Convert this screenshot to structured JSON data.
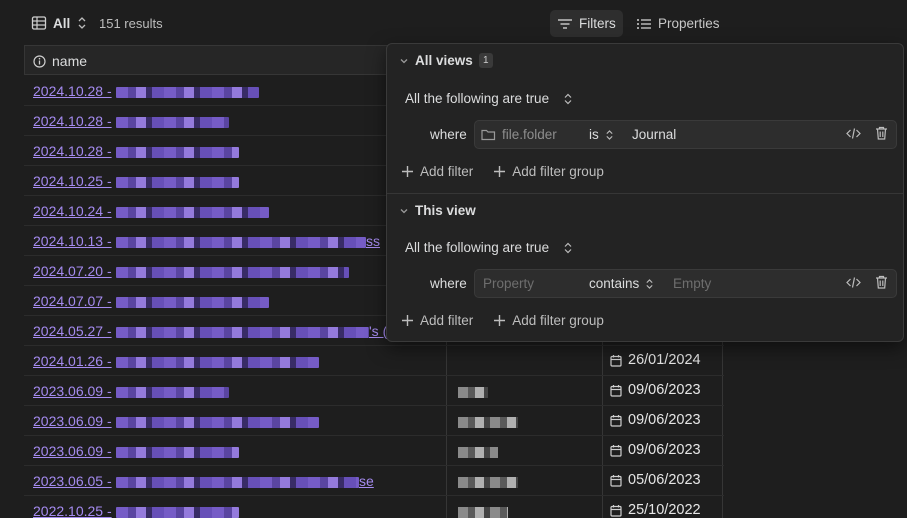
{
  "toolbar": {
    "view_label": "All",
    "results": "151 results",
    "filters_label": "Filters",
    "properties_label": "Properties"
  },
  "table": {
    "header_name": "name",
    "rows": [
      {
        "date": "2024.10.28 -",
        "blur_w": 143,
        "extra": "",
        "right": ""
      },
      {
        "date": "2024.10.28 -",
        "blur_w": 113,
        "extra": "",
        "right": ""
      },
      {
        "date": "2024.10.28 -",
        "blur_w": 123,
        "extra": "",
        "right": ""
      },
      {
        "date": "2024.10.25 -",
        "blur_w": 123,
        "extra": "",
        "right": ""
      },
      {
        "date": "2024.10.24 -",
        "blur_w": 153,
        "extra": "",
        "right": ""
      },
      {
        "date": "2024.10.13 -",
        "blur_w": 250,
        "extra": "ss",
        "right": ""
      },
      {
        "date": "2024.07.20 -",
        "blur_w": 233,
        "extra": "",
        "right": ""
      },
      {
        "date": "2024.07.07 -",
        "blur_w": 153,
        "extra": "",
        "right": ""
      },
      {
        "date": "2024.05.27 -",
        "blur_w": 253,
        "extra": "'s (",
        "right": ""
      },
      {
        "date": "2024.01.26 -",
        "blur_w": 203,
        "extra": "",
        "right": "26/01/2024"
      },
      {
        "date": "2023.06.09 -",
        "blur_w": 113,
        "extra": "",
        "right": "09/06/2023"
      },
      {
        "date": "2023.06.09 -",
        "blur_w": 203,
        "extra": "",
        "right": "09/06/2023"
      },
      {
        "date": "2023.06.09 -",
        "blur_w": 123,
        "extra": "",
        "right": "09/06/2023"
      },
      {
        "date": "2023.06.05 -",
        "blur_w": 243,
        "extra": "se",
        "right": "05/06/2023"
      },
      {
        "date": "2022.10.25 -",
        "blur_w": 123,
        "extra": "",
        "right": "25/10/2022"
      }
    ]
  },
  "filters": {
    "all_views": {
      "title": "All views",
      "badge": "1",
      "conjunction": "All the following are true",
      "where": "where",
      "property": "file.folder",
      "operator": "is",
      "value": "Journal"
    },
    "this_view": {
      "title": "This view",
      "conjunction": "All the following are true",
      "where": "where",
      "property": "Property",
      "operator": "contains",
      "value": "Empty"
    },
    "add_filter": "Add filter",
    "add_filter_group": "Add filter group"
  },
  "colors": {
    "link": "#a58bf0",
    "background": "#1e1e1e",
    "panel": "#232323"
  }
}
